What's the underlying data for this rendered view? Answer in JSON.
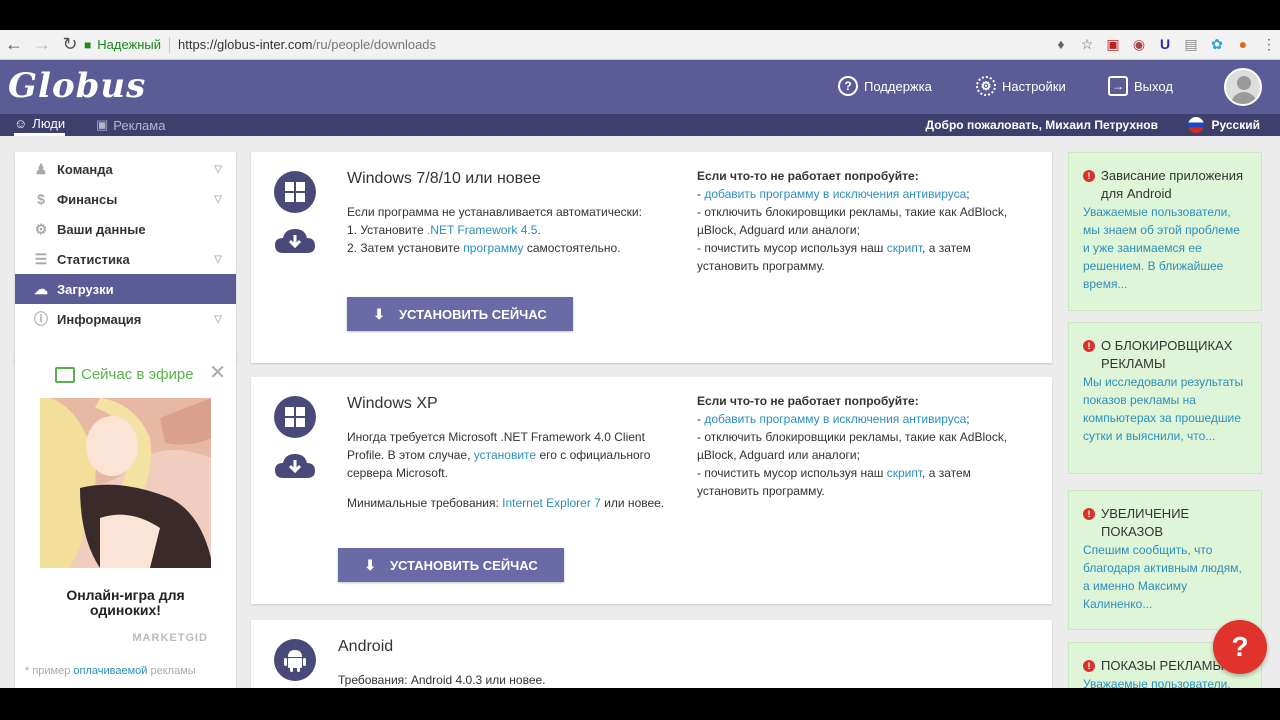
{
  "browser": {
    "secure_label": "Надежный",
    "url_host": "https://globus-inter.com",
    "url_path": "/ru/people/downloads"
  },
  "header": {
    "logo": "Globus",
    "support": "Поддержка",
    "settings": "Настройки",
    "logout": "Выход"
  },
  "subbar": {
    "tab_people": "Люди",
    "tab_ads": "Реклама",
    "welcome": "Добро пожаловать, Михаил Петрухнов",
    "language": "Русский"
  },
  "sidebar": {
    "items": [
      {
        "label": "Команда",
        "icon": "users-icon"
      },
      {
        "label": "Финансы",
        "icon": "dollar-icon"
      },
      {
        "label": "Ваши данные",
        "icon": "gear-icon"
      },
      {
        "label": "Статистика",
        "icon": "list-icon"
      },
      {
        "label": "Загрузки",
        "icon": "cloud-download-icon"
      },
      {
        "label": "Информация",
        "icon": "info-icon"
      }
    ]
  },
  "ad": {
    "heading": "Сейчас в эфире",
    "title": "Онлайн-игра для одиноких!",
    "brand": "MARKETGID",
    "note_prefix": "* пример ",
    "note_link": "оплачиваемой",
    "note_suffix": " рекламы"
  },
  "cards": {
    "win7": {
      "title": "Windows 7/8/10 или новее",
      "line1": "Если программа не устанавливается автоматически:",
      "line2_prefix": "1. Установите ",
      "line2_link": ".NET Framework 4.5",
      "line2_suffix": ".",
      "line3_prefix": "2. Затем установите ",
      "line3_link": "программу",
      "line3_suffix": " самостоятельно.",
      "button": "УСТАНОВИТЬ СЕЙЧАС"
    },
    "winxp": {
      "title": "Windows XP",
      "line1": "Иногда требуется Microsoft .NET Framework 4.0 Client",
      "line2_prefix": "Profile. В этом случае, ",
      "line2_link": "установите",
      "line2_suffix": " его с официального",
      "line3": "сервера Microsoft.",
      "req_prefix": "Минимальные требования: ",
      "req_link": "Internet Explorer 7",
      "req_suffix": " или новее.",
      "button": "УСТАНОВИТЬ СЕЙЧАС"
    },
    "android": {
      "title": "Android",
      "req": "Требования: Android 4.0.3 или новее."
    },
    "tips": {
      "heading": "Если что-то не работает попробуйте:",
      "t1_prefix": "- ",
      "t1_link": "добавить программу в исключения антивируса",
      "t1_suffix": ";",
      "t2": "- отключить блокировщики рекламы, такие как AdBlock,",
      "t3": "µBlock, Adguard или аналоги;",
      "t4_prefix": "- почистить мусор используя наш ",
      "t4_link": "скрипт",
      "t4_suffix": ", а затем",
      "t5": "установить программу."
    }
  },
  "news": [
    {
      "title": "Зависание приложения для Android",
      "body": "Уважаемые пользователи, мы знаем об этой проблеме и уже занимаемся ее решением. В ближайшее время..."
    },
    {
      "title": "О БЛОКИРОВЩИКАХ РЕКЛАМЫ",
      "body": "Мы исследовали результаты показов рекламы на компьютерах за прошедшие сутки и выяснили, что..."
    },
    {
      "title": "УВЕЛИЧЕНИЕ ПОКАЗОВ",
      "body": "Спешим сообщить, что благодаря активным людям, а именно Максиму Калиненко..."
    },
    {
      "title": "ПОКАЗЫ РЕКЛАМЫ",
      "body": "Уважаемые пользователи,"
    }
  ],
  "help_label": "?"
}
